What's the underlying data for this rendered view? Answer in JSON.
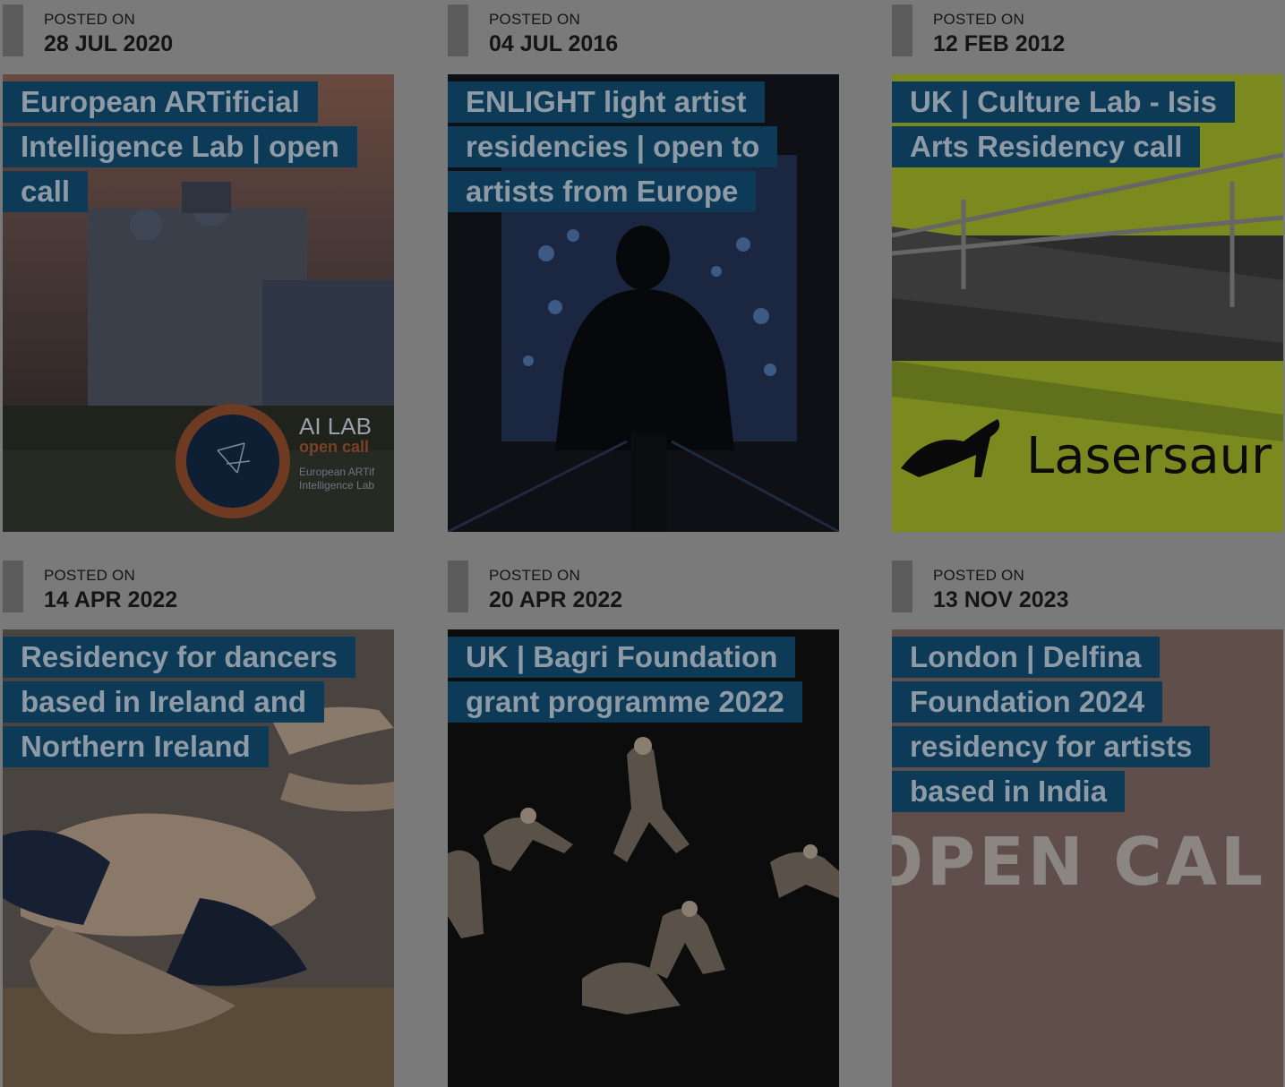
{
  "posts": [
    {
      "posted_label": "POSTED ON",
      "date": "28 JUL 2020",
      "title": "European ARTificial Intelligence Lab | open call",
      "image_text": {
        "line1": "AI LAB",
        "line2": "open call",
        "line3": "European ARTif",
        "line4": "Intelligence Lab"
      }
    },
    {
      "posted_label": "POSTED ON",
      "date": "04 JUL 2016",
      "title": "ENLIGHT light artist residencies | open to artists from Europe"
    },
    {
      "posted_label": "POSTED ON",
      "date": "12 FEB 2012",
      "title": "UK | Culture Lab - Isis Arts Residency call",
      "image_text": {
        "line1": "Lasersaur"
      }
    },
    {
      "posted_label": "POSTED ON",
      "date": "14 APR 2022",
      "title": "Residency for dancers based in Ireland and Northern Ireland"
    },
    {
      "posted_label": "POSTED ON",
      "date": "20 APR 2022",
      "title": "UK | Bagri Foundation grant programme 2022"
    },
    {
      "posted_label": "POSTED ON",
      "date": "13 NOV 2023",
      "title": "London | Delfina Foundation 2024 residency for artists based in India",
      "image_text": {
        "line1": "OPEN CAL"
      }
    }
  ],
  "colors": {
    "overlay_bg": "#7a7a7a",
    "title_bg": "#0d3a57",
    "title_text": "#8e9ba6"
  }
}
